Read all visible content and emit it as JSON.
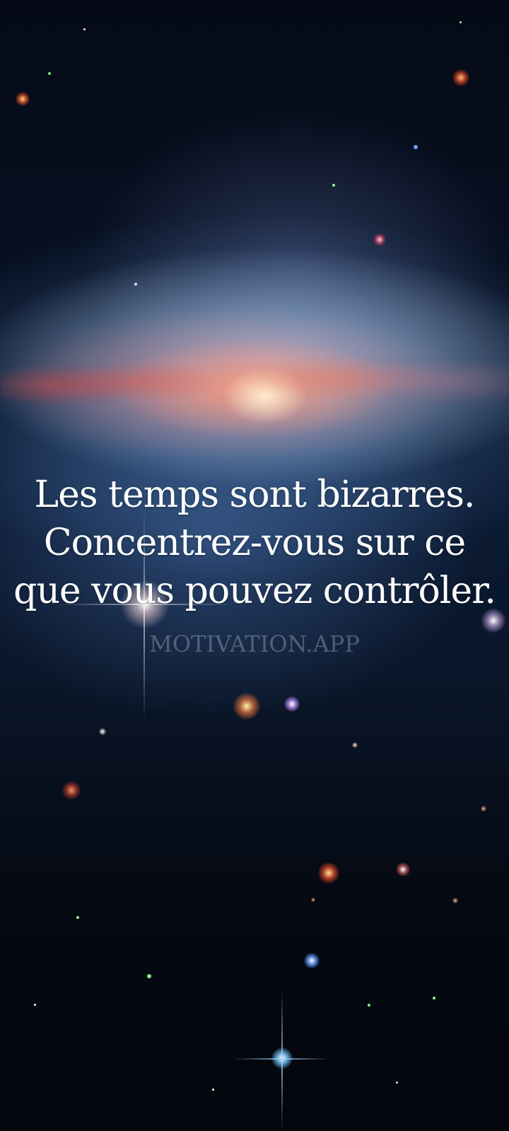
{
  "quote": {
    "lines": [
      "Les temps sont bizarres.",
      "Concentrez-vous sur ce",
      "que vous pouvez contrôler."
    ]
  },
  "watermark": "MOTIVATION.APP",
  "background": {
    "type": "galaxy-space-image",
    "colors": {
      "space": "#050a16",
      "core": "#fff0d2",
      "dust": "#d24646",
      "halo": "#c8e1ff"
    }
  }
}
